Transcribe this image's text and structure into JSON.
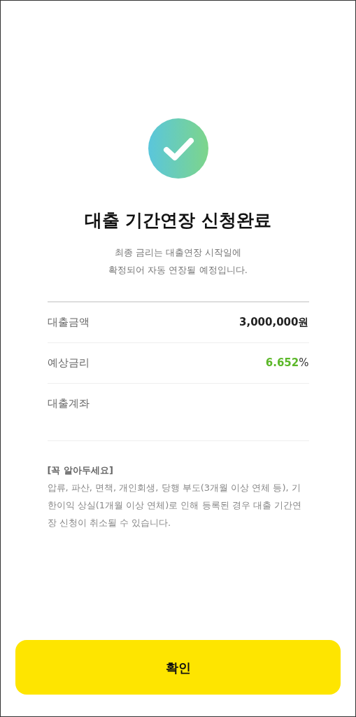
{
  "title": "대출 기간연장 신청완료",
  "subtitle": [
    "최종 금리는 대출연장 시작일에",
    "확정되어 자동 연장될 예정입니다."
  ],
  "details": [
    {
      "label": "대출금액",
      "value": "3,000,000원",
      "color": "#222222"
    },
    {
      "label": "예상금리",
      "value": "6.652",
      "unit": "%",
      "color": "#5cb82a"
    },
    {
      "label": "대출계좌"
    }
  ],
  "notice": {
    "title": "[꼭 알아두세요]",
    "body": "압류, 파산, 면책, 개인회생, 당행 부도(3개월 이상 연체 등), 기한이익 상실(1개월 이상 연체)로 인해 등록된 경우 대출 기간연장 신청이 취소될 수 있습니다."
  },
  "confirm_button": "확인"
}
